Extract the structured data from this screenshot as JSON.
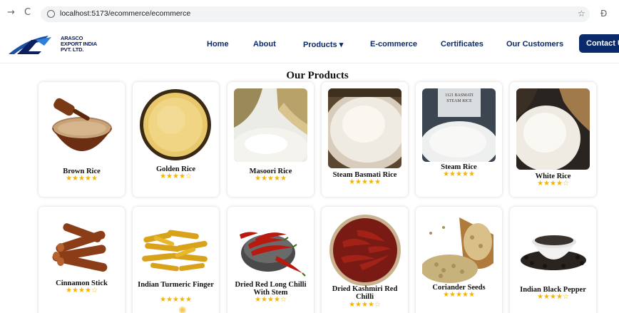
{
  "browser": {
    "back_icon": "→",
    "reload_icon": "C",
    "url": "localhost:5173/ecommerce/ecommerce",
    "bookmark_icon": "☆",
    "extension_icon": "Ð"
  },
  "header": {
    "logo_lines": [
      "ARASCO",
      "EXPORT INDIA",
      "PVT. LTD."
    ],
    "nav": [
      {
        "label": "Home"
      },
      {
        "label": "About"
      },
      {
        "label": "Products  ▾"
      },
      {
        "label": "E-commerce"
      },
      {
        "label": "Certificates"
      },
      {
        "label": "Our Customers"
      }
    ],
    "contact_label": "Contact U"
  },
  "main": {
    "title": "Our Products",
    "products": [
      {
        "name": "Brown Rice",
        "stars": "★★★★★",
        "rating": 5
      },
      {
        "name": "Golden Rice",
        "stars": "★★★★☆",
        "rating": 3.5
      },
      {
        "name": "Masoori Rice",
        "stars": "★★★★★",
        "rating": 4.5
      },
      {
        "name": "Steam Basmati Rice",
        "stars": "★★★★★",
        "rating": 5
      },
      {
        "name": "Steam Rice",
        "stars": "★★★★★",
        "rating": 5,
        "bag_label": "1121 BASMATI STEAM RICE"
      },
      {
        "name": "White Rice",
        "stars": "★★★★☆",
        "rating": 4
      },
      {
        "name": "Cinnamon Stick",
        "stars": "★★★★☆",
        "rating": 3.5
      },
      {
        "name": "Indian Turmeric Finger",
        "stars": "★★★★★",
        "rating": 4.5
      },
      {
        "name": "Dried Red Long Chilli With Stem",
        "stars": "★★★★☆",
        "rating": 4
      },
      {
        "name": "Dried Kashmiri Red Chilli",
        "stars": "★★★★☆",
        "rating": 3.5
      },
      {
        "name": "Coriander Seeds",
        "stars": "★★★★★",
        "rating": 5
      },
      {
        "name": "Indian Black Pepper",
        "stars": "★★★★☆",
        "rating": 4
      }
    ]
  },
  "colors": {
    "brand_navy": "#0b2a6b",
    "star_gold": "#f5b301"
  },
  "icons": {
    "back": "arrow-right-icon",
    "reload": "reload-icon",
    "site_info": "info-icon",
    "bookmark": "star-icon",
    "extensions": "puzzle-icon",
    "dropdown": "chevron-down-icon",
    "sun": "sun-icon"
  }
}
